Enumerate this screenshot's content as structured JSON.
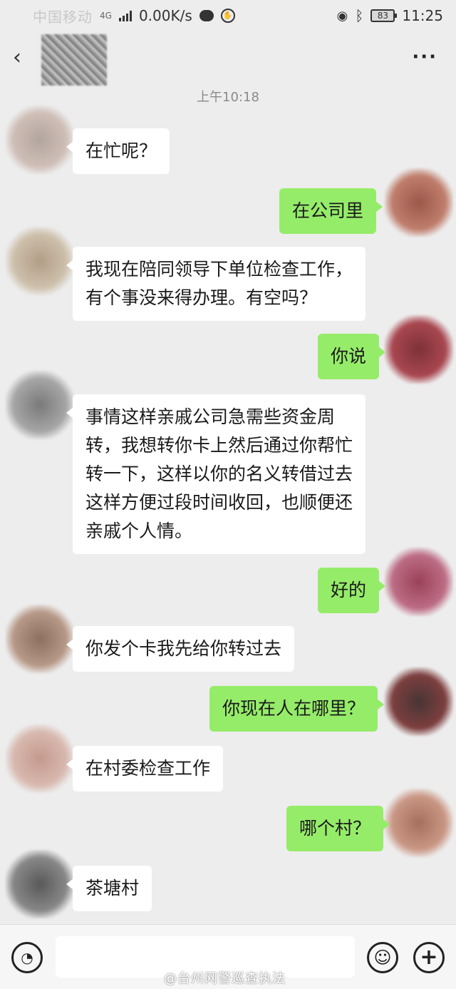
{
  "status_bar": {
    "carrier": "中国移动",
    "network_tags": "4G",
    "speed": "0.00K/s",
    "battery": "83",
    "time": "11:25"
  },
  "nav": {
    "back_icon": "chevron-left-icon",
    "more_icon": "more-icon"
  },
  "chat": {
    "timestamp": "上午10:18",
    "messages": [
      {
        "side": "left",
        "text": "在忙呢？"
      },
      {
        "side": "right",
        "text": "在公司里"
      },
      {
        "side": "left",
        "lines": [
          "我现在陪同领导下单位检查工作，",
          "有个事没来得办理。有空吗？"
        ]
      },
      {
        "side": "right",
        "text": "你说"
      },
      {
        "side": "left",
        "lines": [
          "事情这样亲戚公司急需些资金周",
          "转，我想转你卡上然后通过你帮忙",
          "转一下，这样以你的名义转借过去",
          "这样方便过段时间收回，也顺便还",
          "亲戚个人情。"
        ]
      },
      {
        "side": "right",
        "text": "好的"
      },
      {
        "side": "left",
        "text": "你发个卡我先给你转过去"
      },
      {
        "side": "right",
        "text": "你现在人在哪里？"
      },
      {
        "side": "left",
        "text": "在村委检查工作"
      },
      {
        "side": "right",
        "text": "哪个村？"
      },
      {
        "side": "left",
        "text": "茶塘村"
      }
    ]
  },
  "input_bar": {
    "placeholder": "",
    "voice_icon": "voice-icon",
    "emoji_icon": "emoji-icon",
    "plus_icon": "plus-icon"
  },
  "watermark": "@台州网警巡查执法",
  "colors": {
    "background": "#ededed",
    "sent_bubble": "#95ec69",
    "received_bubble": "#ffffff"
  }
}
